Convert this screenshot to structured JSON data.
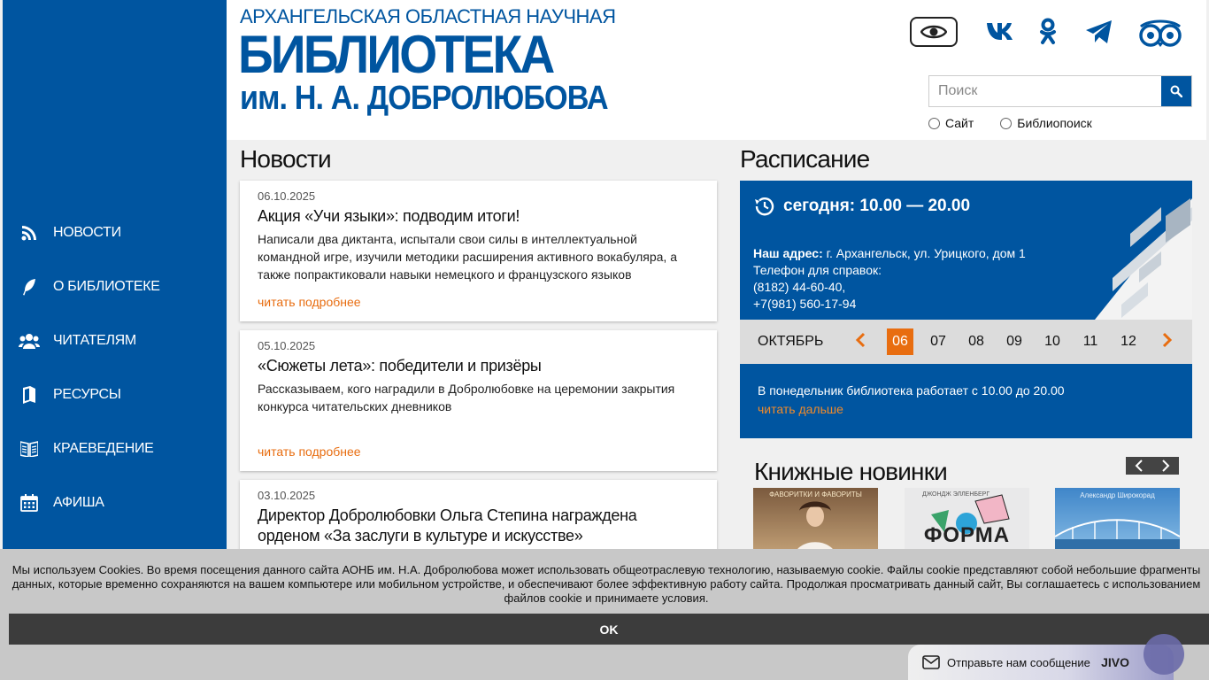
{
  "header": {
    "subtitle": "АРХАНГЕЛЬСКАЯ ОБЛАСТНАЯ НАУЧНАЯ",
    "title": "БИБЛИОТЕКА",
    "name": "им. Н. А. ДОБРОЛЮБОВА"
  },
  "search": {
    "placeholder": "Поиск",
    "options": [
      "Сайт",
      "Библиопоиск"
    ]
  },
  "nav": {
    "items": [
      {
        "label": "НОВОСТИ",
        "icon": "rss-icon"
      },
      {
        "label": "О БИБЛИОТЕКЕ",
        "icon": "feather-icon"
      },
      {
        "label": "ЧИТАТЕЛЯМ",
        "icon": "users-icon"
      },
      {
        "label": "РЕСУРСЫ",
        "icon": "book-icon"
      },
      {
        "label": "КРАЕВЕДЕНИЕ",
        "icon": "open-book-icon"
      },
      {
        "label": "АФИША",
        "icon": "calendar-icon"
      }
    ]
  },
  "news": {
    "heading": "Новости",
    "more_label": "читать подробнее",
    "items": [
      {
        "date": "06.10.2025",
        "title": "Акция «Учи языки»: подводим итоги!",
        "text": "Написали два диктанта, испытали свои силы в интеллектуальной командной игре, изучили методики расширения активного вокабуляра, а также попрактиковали навыки немецкого и французского языков"
      },
      {
        "date": "05.10.2025",
        "title": "«Сюжеты лета»: победители и призёры",
        "text": "Рассказываем, кого наградили в Добролюбовке на церемонии закрытия конкурса читательских дневников"
      },
      {
        "date": "03.10.2025",
        "title": "Директор Добролюбовки Ольга Степина награждена орденом «За заслуги в культуре и искусстве»",
        "text": ""
      }
    ]
  },
  "schedule": {
    "heading": "Расписание",
    "today": "сегодня: 10.00 — 20.00",
    "address_label": "Наш адрес:",
    "address": "г. Архангельск, ул. Урицкого, дом 1",
    "phone_label": "Телефон для справок:",
    "phone1": "(8182) 44-60-40,",
    "phone2": "+7(981) 560-17-94",
    "month": "ОКТЯБРЬ",
    "days": [
      "06",
      "07",
      "08",
      "09",
      "10",
      "11",
      "12"
    ],
    "active_day": "06",
    "info": "В понедельник библиотека работает с 10.00 до 20.00",
    "info_more": "читать дальше"
  },
  "books": {
    "heading": "Книжные новинки",
    "items": [
      {
        "cover_text": "ФАВОРИТКИ И ФАВОРИТЫ"
      },
      {
        "cover_text": "ФОРМА",
        "author": "ДЖОНДЖ ЭЛЛЕНБЕРГ"
      },
      {
        "cover_text": "Александр Широкорад"
      }
    ]
  },
  "cookie": {
    "text": "Мы используем Cookies. Во время посещения данного сайта АОНБ им. Н.А. Добролюбова может использовать общеотраслевую технологию, называемую cookie. Файлы cookie представляют собой небольшие фрагменты данных, которые временно сохраняются на вашем компьютере или мобильном устройстве, и обеспечивают более эффективную работу сайта. Продолжая просматривать данный сайт, Вы соглашаетесь с использованием файлов cookie и принимаете условия.",
    "ok": "OK"
  },
  "jivo": {
    "label": "Отправьте нам сообщение",
    "brand": "JIVO"
  },
  "colors": {
    "brand_blue": "#0055a0",
    "accent_orange": "#e86d10"
  }
}
